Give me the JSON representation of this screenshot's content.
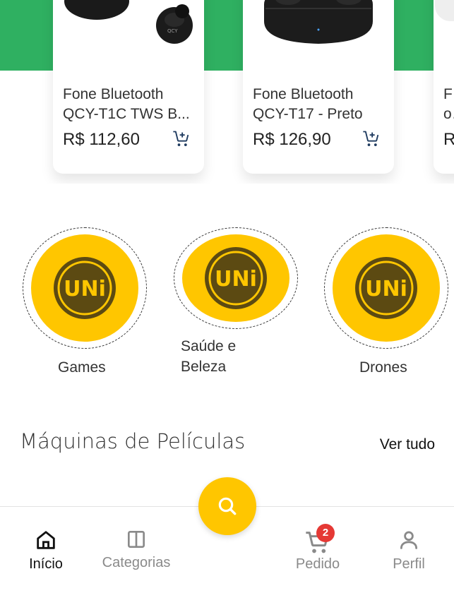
{
  "products": [
    {
      "name": "Fone Bluetooth QCY-T1C TWS B...",
      "price": "R$ 112,60",
      "image_icon": "earbuds-icon"
    },
    {
      "name": "Fone Bluetooth QCY-T17 - Preto",
      "price": "R$ 126,90",
      "image_icon": "earbuds-case-icon"
    },
    {
      "name": "Fo JB",
      "price": "R",
      "image_icon": "product-image-icon"
    }
  ],
  "categories": [
    {
      "label": "Games",
      "logo_text": "UNi"
    },
    {
      "label": "Saúde e Beleza",
      "logo_text": "UNi"
    },
    {
      "label": "Drones",
      "logo_text": "UNi"
    }
  ],
  "section": {
    "title": "Máquinas de Películas",
    "see_all": "Ver tudo"
  },
  "bottom_nav": {
    "items": [
      {
        "label": "Início",
        "icon": "home-icon",
        "active": true
      },
      {
        "label": "Categorias",
        "icon": "columns-icon",
        "active": false
      },
      {
        "label": "Pedido",
        "icon": "cart-icon",
        "badge": "2",
        "active": false
      },
      {
        "label": "Perfil",
        "icon": "person-icon",
        "active": false
      }
    ],
    "fab_icon": "search-icon"
  },
  "colors": {
    "brand_green": "#2fb061",
    "accent_yellow": "#ffc600",
    "badge_red": "#e53935",
    "logo_brown": "#5c4a12"
  }
}
